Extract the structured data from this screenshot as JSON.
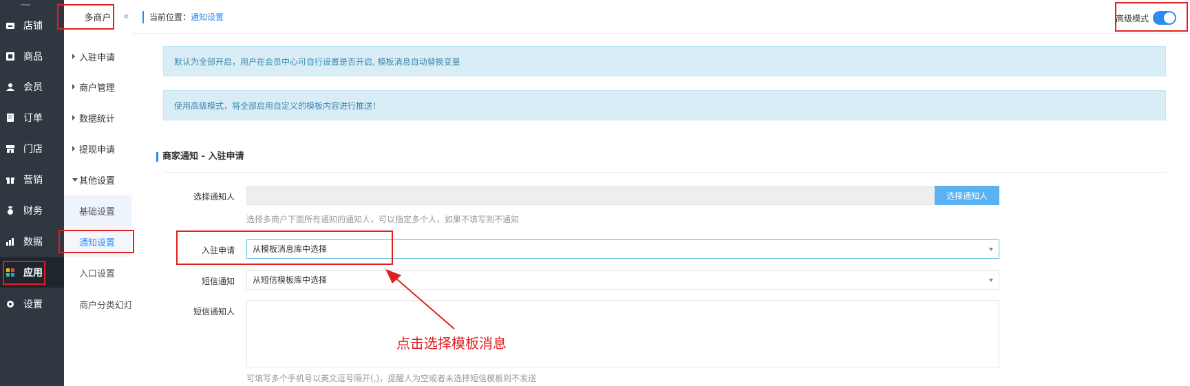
{
  "sidebar": {
    "items": [
      {
        "label": "店铺",
        "icon": "store-icon"
      },
      {
        "label": "商品",
        "icon": "goods-icon"
      },
      {
        "label": "会员",
        "icon": "member-icon"
      },
      {
        "label": "订单",
        "icon": "order-icon"
      },
      {
        "label": "门店",
        "icon": "shop-icon"
      },
      {
        "label": "营销",
        "icon": "gift-icon"
      },
      {
        "label": "财务",
        "icon": "finance-icon"
      },
      {
        "label": "数据",
        "icon": "chart-icon"
      },
      {
        "label": "应用",
        "icon": "apps-icon",
        "active": true
      },
      {
        "label": "设置",
        "icon": "gear-icon"
      }
    ]
  },
  "subnav": {
    "title": "多商户",
    "collapse_icon": "«",
    "groups": [
      {
        "label": "入驻申请"
      },
      {
        "label": "商户管理"
      },
      {
        "label": "数据统计"
      },
      {
        "label": "提现申请"
      },
      {
        "label": "其他设置",
        "expanded": true
      }
    ],
    "sub_items": [
      {
        "label": "基础设置"
      },
      {
        "label": "通知设置",
        "active": true
      },
      {
        "label": "入口设置"
      },
      {
        "label": "商户分类幻灯"
      }
    ]
  },
  "breadcrumb": {
    "prefix": "当前位置：",
    "current": "通知设置"
  },
  "advanced_mode": {
    "label": "高级模式",
    "enabled": true
  },
  "alerts": [
    "默认为全部开启，用户在会员中心可自行设置是否开启, 模板消息自动替换变量",
    "使用高级模式，将全部启用自定义的模板内容进行推送！"
  ],
  "section": {
    "title": "商家通知 - 入驻申请"
  },
  "form": {
    "notify_person": {
      "label": "选择通知人",
      "value": "",
      "button": "选择通知人",
      "help": "选择多商户下面所有通知的通知人，可以指定多个人，如果不填写则不通知"
    },
    "apply": {
      "label": "入驻申请",
      "value": "从模板消息库中选择"
    },
    "sms": {
      "label": "短信通知",
      "value": "从短信模板库中选择"
    },
    "sms_person": {
      "label": "短信通知人",
      "value": "",
      "help": "可填写多个手机号以英文逗号隔开(,)，提醒人为空或者未选择短信模板则不发送"
    }
  },
  "annotation": {
    "text": "点击选择模板消息",
    "color": "#e02020"
  },
  "colors": {
    "accent": "#2d8cf0",
    "sidebar_bg": "#2f3740",
    "alert_bg": "#d9edf7",
    "alert_text": "#3a87ad"
  }
}
